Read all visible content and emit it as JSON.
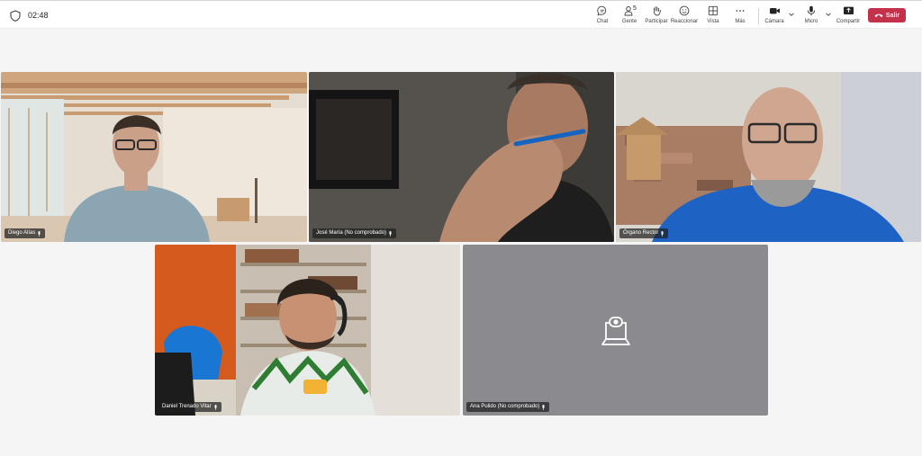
{
  "header": {
    "timer": "02:48",
    "toolbar": {
      "chat": "Chat",
      "people": "Gente",
      "people_count": "5",
      "raise": "Participar",
      "react": "Reaccionar",
      "view": "Vista",
      "more": "Más",
      "camera": "Cámara",
      "mic": "Micro",
      "share": "Compartir",
      "leave": "Salir"
    }
  },
  "participants": [
    {
      "name": "Diego Alías",
      "camera_on": true
    },
    {
      "name": "José María (No comprobado)",
      "camera_on": true,
      "active_speaker": true
    },
    {
      "name": "Órgano Rector",
      "camera_on": true,
      "active_speaker": true
    },
    {
      "name": "Daniel Trenado Vitar",
      "camera_on": true
    },
    {
      "name": "Ana Pulido (No comprobado)",
      "camera_on": false
    }
  ],
  "colors": {
    "accent": "#5b5fc7",
    "leave": "#c4314b",
    "camera_off_tile": "#8a8a8f"
  }
}
